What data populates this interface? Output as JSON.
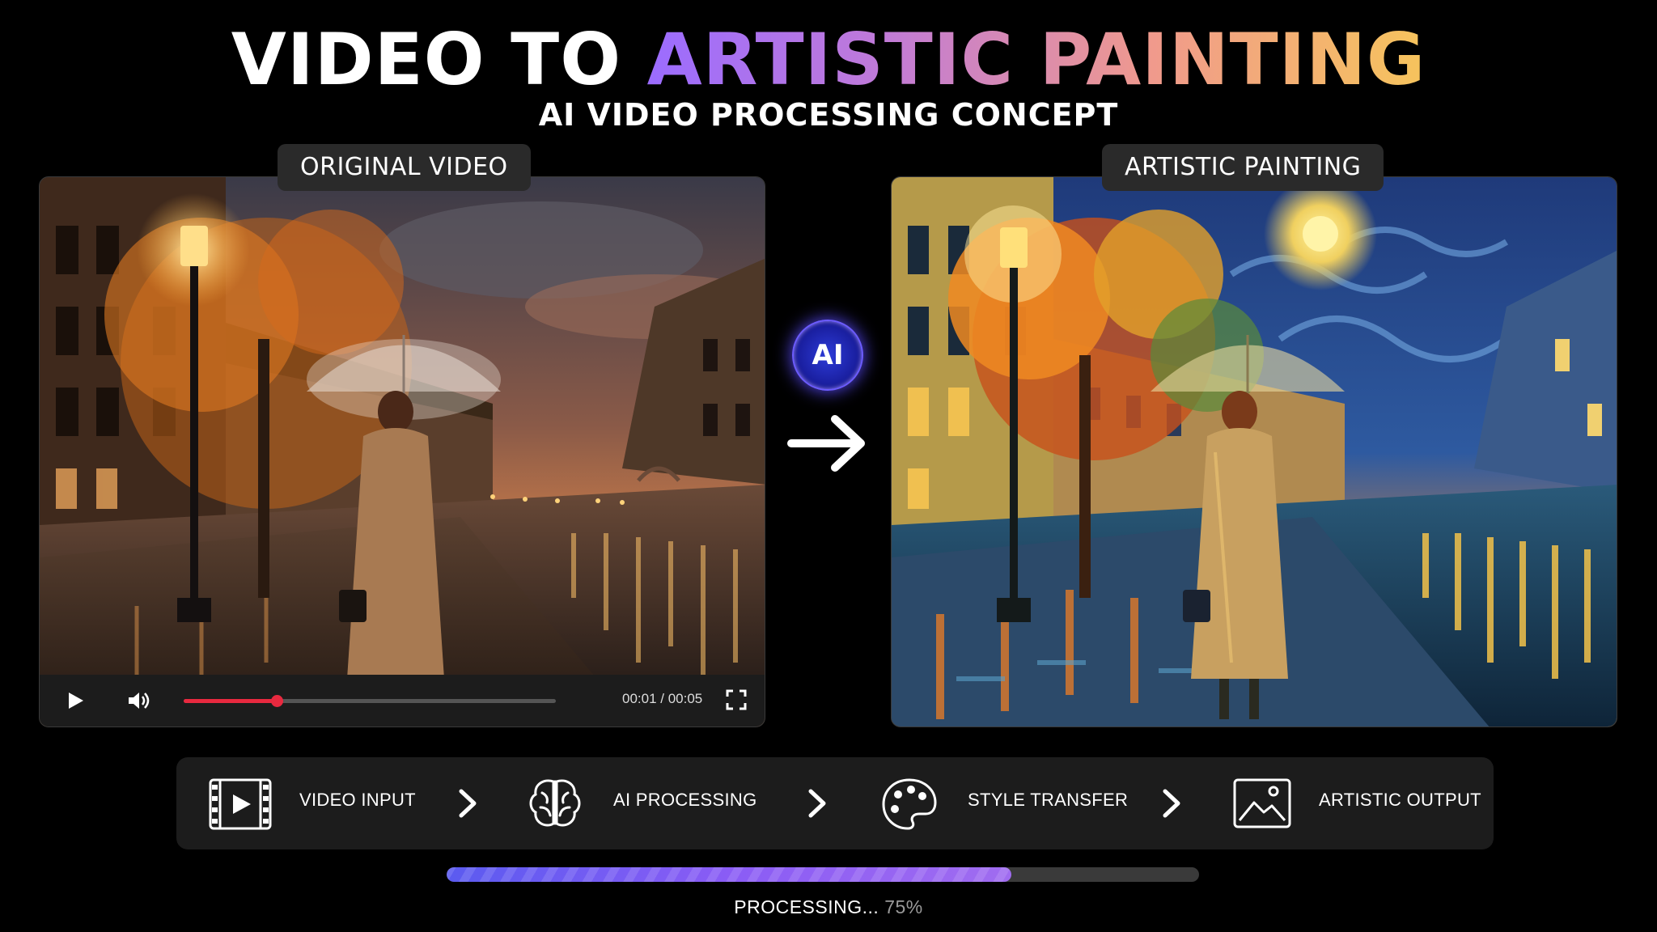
{
  "header": {
    "title_part1": "VIDEO TO ",
    "title_part2": "ARTISTIC PAINTING",
    "subtitle": "AI VIDEO PROCESSING CONCEPT"
  },
  "original_panel": {
    "label": "ORIGINAL VIDEO",
    "player": {
      "time": "00:01 / 00:05",
      "progress": 0.25,
      "play_icon": "play-icon",
      "volume_icon": "volume-icon",
      "fullscreen_icon": "fullscreen-icon"
    }
  },
  "painting_panel": {
    "label": "ARTISTIC PAINTING"
  },
  "center": {
    "ai_badge": "AI",
    "arrow_icon": "arrow-right-icon"
  },
  "pipeline": {
    "steps": [
      {
        "label": "VIDEO INPUT",
        "icon": "film-icon"
      },
      {
        "label": "AI PROCESSING",
        "icon": "brain-icon"
      },
      {
        "label": "STYLE TRANSFER",
        "icon": "palette-icon"
      },
      {
        "label": "ARTISTIC OUTPUT",
        "icon": "image-icon"
      }
    ]
  },
  "processing": {
    "label": "PROCESSING...",
    "percent_text": "75%",
    "progress": 0.75
  },
  "colors": {
    "accent_purple": "#9b6cff",
    "accent_gold": "#f6c45c",
    "seek_red": "#e8293f"
  }
}
